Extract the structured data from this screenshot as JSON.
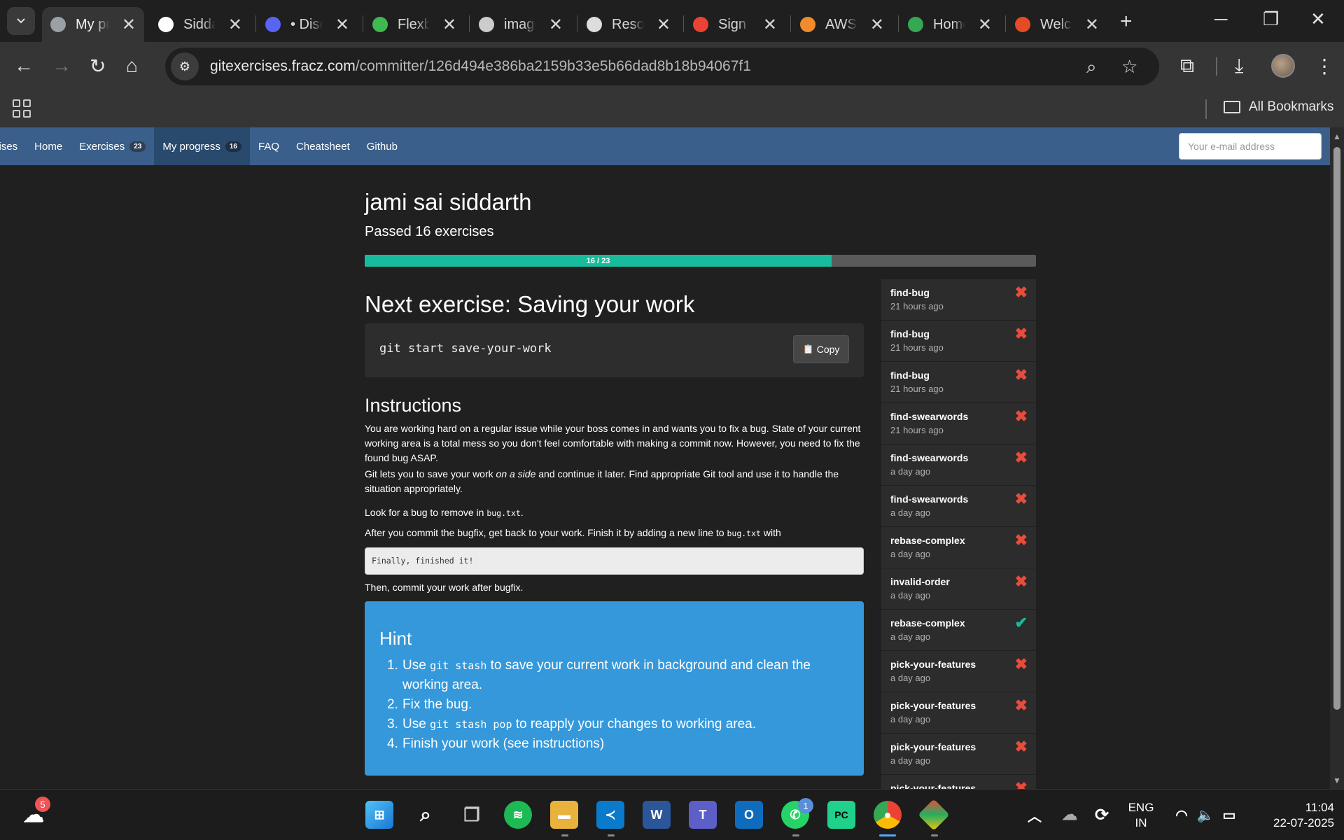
{
  "browser": {
    "tabs": [
      {
        "label": "My pr",
        "icon": "globe-icon",
        "color": "#9aa0a6",
        "active": true
      },
      {
        "label": "Sidda",
        "icon": "github-icon",
        "color": "#ffffff"
      },
      {
        "label": "• Disc",
        "icon": "discord-icon",
        "color": "#5865f2"
      },
      {
        "label": "Flexb",
        "icon": "frog-icon",
        "color": "#3fb950"
      },
      {
        "label": "image",
        "icon": "image-icon",
        "color": "#cccccc"
      },
      {
        "label": "Resol",
        "icon": "openai-icon",
        "color": "#dddddd"
      },
      {
        "label": "Sign u",
        "icon": "gmail-icon",
        "color": "#ea4335"
      },
      {
        "label": "AWS (",
        "icon": "aws-icon",
        "color": "#f28b2c"
      },
      {
        "label": "Home",
        "icon": "drive-icon",
        "color": "#34a853"
      },
      {
        "label": "Welco",
        "icon": "welcome-icon",
        "color": "#e34c26"
      }
    ],
    "url_host": "gitexercises.fracz.com",
    "url_path": "/committer/126d494e386ba2159b33e5b66dad8b18b94067f1",
    "bookmarks_label": "All Bookmarks"
  },
  "site": {
    "nav": {
      "brand": "rcises",
      "home": "Home",
      "exercises": "Exercises",
      "exercises_count": "23",
      "progress": "My progress",
      "progress_count": "16",
      "faq": "FAQ",
      "cheatsheet": "Cheatsheet",
      "github": "Github",
      "email_placeholder": "Your e-mail address"
    },
    "user_name": "jami sai siddarth",
    "passed_text": "Passed 16 exercises",
    "progress_label": "16 / 23",
    "progress_fraction": 0.6957,
    "next_title": "Next exercise: Saving your work",
    "command": "git start save-your-work",
    "copy_label": "Copy",
    "instructions_title": "Instructions",
    "p1": "You are working hard on a regular issue while your boss comes in and wants you to fix a bug. State of your current working area is a total mess so you don't feel comfortable with making a commit now. However, you need to fix the found bug ASAP.",
    "p2a": "Git lets you to save your work ",
    "p2b": "on a side",
    "p2c": " and continue it later. Find appropriate Git tool and use it to handle the situation appropriately.",
    "p3a": "Look for a bug to remove in ",
    "p3code": "bug.txt",
    "p3b": ".",
    "p4a": "After you commit the bugfix, get back to your work. Finish it by adding a new line to ",
    "p4code": "bug.txt",
    "p4b": " with",
    "pre": "Finally, finished it!",
    "p5": "Then, commit your work after bugfix.",
    "hint_title": "Hint",
    "hints": [
      {
        "num": "1.",
        "a": "Use ",
        "code": "git stash",
        "b": " to save your current work in background and clean the working area."
      },
      {
        "num": "2.",
        "a": "Fix the bug.",
        "code": "",
        "b": ""
      },
      {
        "num": "3.",
        "a": "Use ",
        "code": "git stash pop",
        "b": " to reapply your changes to working area."
      },
      {
        "num": "4.",
        "a": "Finish your work (see instructions)",
        "code": "",
        "b": ""
      }
    ],
    "attempts": [
      {
        "name": "find-bug",
        "time": "21 hours ago",
        "status": "fail"
      },
      {
        "name": "find-bug",
        "time": "21 hours ago",
        "status": "fail"
      },
      {
        "name": "find-bug",
        "time": "21 hours ago",
        "status": "fail"
      },
      {
        "name": "find-swearwords",
        "time": "21 hours ago",
        "status": "fail"
      },
      {
        "name": "find-swearwords",
        "time": "a day ago",
        "status": "fail"
      },
      {
        "name": "find-swearwords",
        "time": "a day ago",
        "status": "fail"
      },
      {
        "name": "rebase-complex",
        "time": "a day ago",
        "status": "fail"
      },
      {
        "name": "invalid-order",
        "time": "a day ago",
        "status": "fail"
      },
      {
        "name": "rebase-complex",
        "time": "a day ago",
        "status": "pass"
      },
      {
        "name": "pick-your-features",
        "time": "a day ago",
        "status": "fail"
      },
      {
        "name": "pick-your-features",
        "time": "a day ago",
        "status": "fail"
      },
      {
        "name": "pick-your-features",
        "time": "a day ago",
        "status": "fail"
      },
      {
        "name": "pick-your-features",
        "time": "",
        "status": "fail"
      }
    ],
    "fail_glyph": "✖",
    "pass_glyph": "✔"
  },
  "taskbar": {
    "weather_badge": "5",
    "whatsapp_badge": "1",
    "lang_top": "ENG",
    "lang_bottom": "IN",
    "time": "11:04",
    "date": "22-07-2025"
  }
}
